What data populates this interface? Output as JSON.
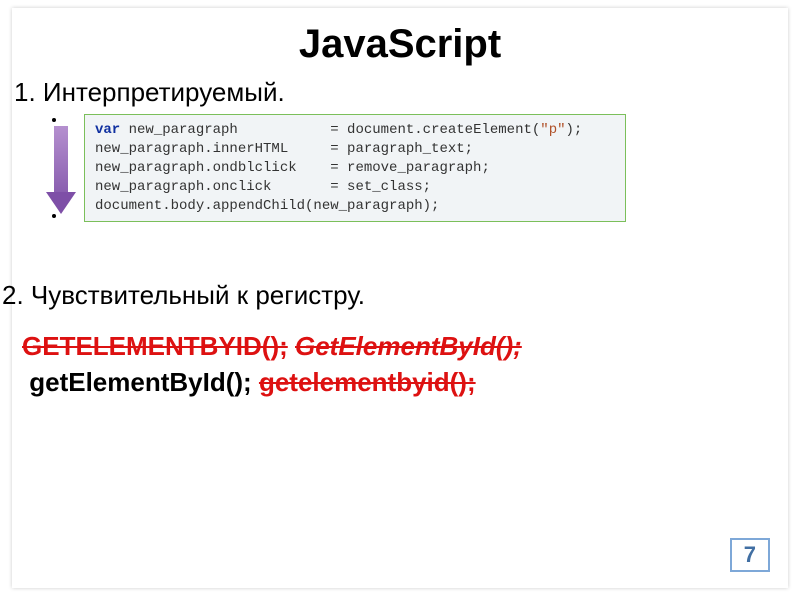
{
  "title": "JavaScript",
  "point1": "1. Интерпретируемый.",
  "code": {
    "l1_var": "var",
    "l1_a": " new_paragraph           = document.createElement(",
    "l1_str": "\"p\"",
    "l1_b": ");",
    "l2": "new_paragraph.innerHTML     = paragraph_text;",
    "l3": "new_paragraph.ondblclick    = remove_paragraph;",
    "l4": "new_paragraph.onclick       = set_class;",
    "l5": "document.body.appendChild(new_paragraph);"
  },
  "point2": "2. Чувствительный к регистру.",
  "examples": {
    "e1": "GETELEMENTBYID();",
    "e2": "GetElementById();",
    "e3": "getElementById();",
    "e4": "getelementbyid();"
  },
  "page": "7"
}
